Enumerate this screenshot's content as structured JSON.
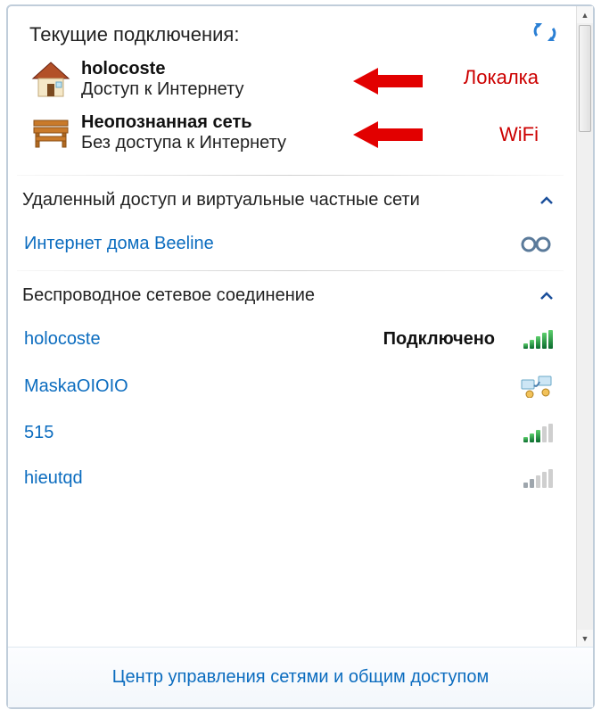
{
  "header": {
    "title": "Текущие подключения:"
  },
  "connections": [
    {
      "name": "holocoste",
      "status": "Доступ к Интернету",
      "annotation": "Локалка"
    },
    {
      "name": "Неопознанная сеть",
      "status": "Без доступа к Интернету",
      "annotation": "WiFi"
    }
  ],
  "sections": {
    "vpn_title": "Удаленный доступ и виртуальные частные сети",
    "vpn_item": "Интернет дома Beeline",
    "wireless_title": "Беспроводное сетевое соединение"
  },
  "wireless_networks": [
    {
      "name": "holocoste",
      "status": "Подключено",
      "strength": 5,
      "color": "green"
    },
    {
      "name": "MaskaOIOIO",
      "status": "",
      "strength": 0,
      "shared": true
    },
    {
      "name": "515",
      "status": "",
      "strength": 3,
      "color": "green"
    },
    {
      "name": "hieutqd",
      "status": "",
      "strength": 2,
      "color": "gray"
    }
  ],
  "footer": {
    "link": "Центр управления сетями и общим доступом"
  }
}
